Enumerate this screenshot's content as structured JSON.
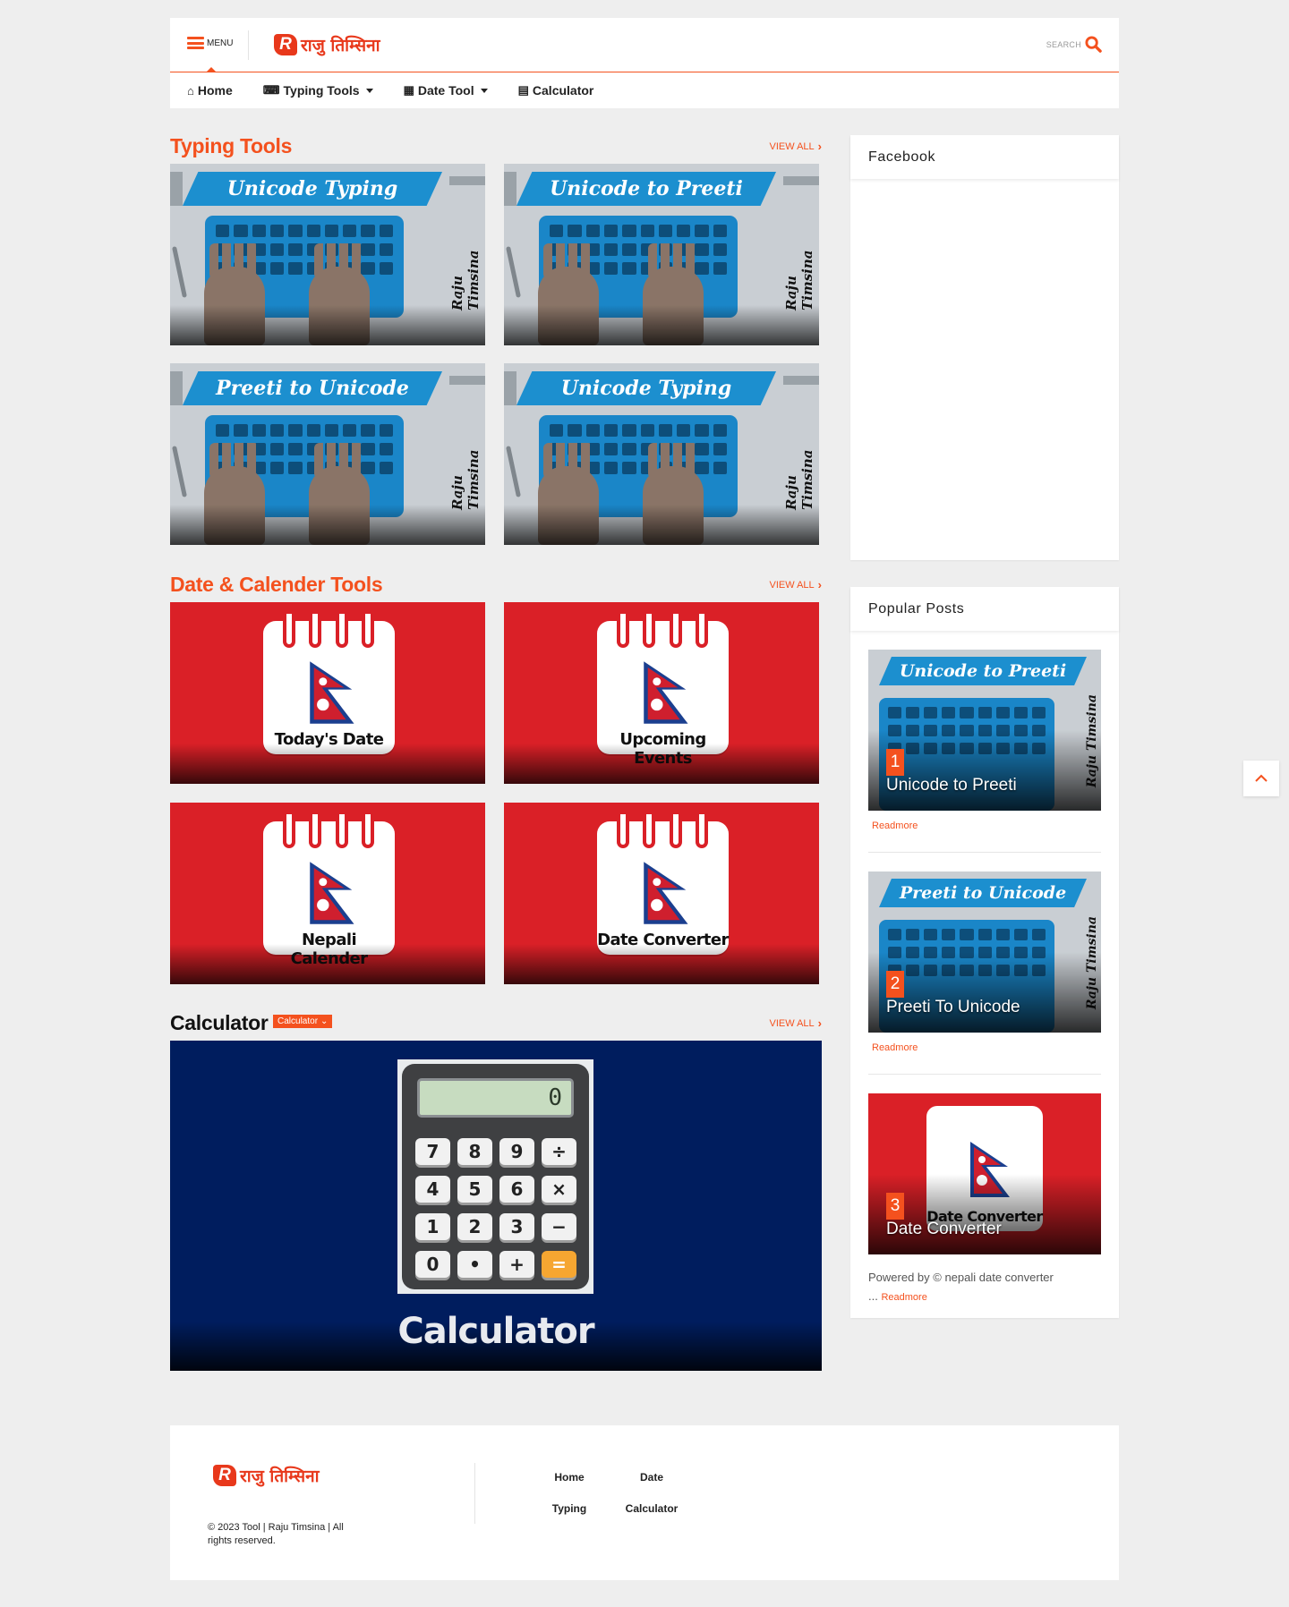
{
  "header": {
    "menu_label": "MENU",
    "logo_mark": "R",
    "logo_text": "राजु तिम्सिना",
    "search_label": "SEARCH"
  },
  "nav": [
    {
      "label": "Home",
      "icon": "home-icon",
      "dropdown": false
    },
    {
      "label": "Typing Tools",
      "icon": "keyboard-icon",
      "dropdown": true
    },
    {
      "label": "Date Tool",
      "icon": "calendar-icon",
      "dropdown": true
    },
    {
      "label": "Calculator",
      "icon": "calculator-icon",
      "dropdown": false
    }
  ],
  "sections": {
    "typing": {
      "title": "Typing Tools",
      "view_all": "VIEW ALL",
      "cards": [
        {
          "banner": "Unicode Typing",
          "signature": "Raju Timsina"
        },
        {
          "banner": "Unicode to Preeti",
          "signature": "Raju Timsina"
        },
        {
          "banner": "Preeti to Unicode",
          "signature": "Raju Timsina"
        },
        {
          "banner": "Unicode Typing",
          "signature": "Raju Timsina"
        }
      ]
    },
    "date": {
      "title": "Date & Calender Tools",
      "view_all": "VIEW ALL",
      "cards": [
        {
          "caption": "Today's Date"
        },
        {
          "caption": "Upcoming Events"
        },
        {
          "caption": "Nepali Calender"
        },
        {
          "caption": "Date Converter"
        }
      ]
    },
    "calculator": {
      "title": "Calculator",
      "chip": "Calculator",
      "view_all": "VIEW ALL",
      "image_word": "Calculator",
      "display": "0",
      "keys": [
        "7",
        "8",
        "9",
        "÷",
        "4",
        "5",
        "6",
        "×",
        "1",
        "2",
        "3",
        "−",
        "0",
        "•",
        "+",
        "="
      ]
    }
  },
  "sidebar": {
    "facebook_title": "Facebook",
    "popular_title": "Popular Posts",
    "posts": [
      {
        "rank": "1",
        "title": "Unicode to Preeti",
        "banner": "Unicode to Preeti",
        "signature": "Raju Timsina",
        "readmore": "Readmore"
      },
      {
        "rank": "2",
        "title": "Preeti To Unicode",
        "banner": "Preeti to Unicode",
        "signature": "Raju Timsina",
        "readmore": "Readmore"
      },
      {
        "rank": "3",
        "title": "Date Converter",
        "caption": "Date Converter",
        "excerpt": "Powered by © nepali date converter",
        "ellipsis": "...",
        "readmore": "Readmore"
      }
    ]
  },
  "footer": {
    "logo_mark": "R",
    "logo_text": "राजु तिम्सिना",
    "copyright": "© 2023 Tool | Raju Timsina | All rights reserved.",
    "links": [
      "Home",
      "Date",
      "Typing",
      "Calculator"
    ]
  },
  "colors": {
    "accent": "#f4511e",
    "calendar_red": "#da2027",
    "keyboard_blue": "#1a86c8",
    "calculator_navy": "#001d5e"
  }
}
